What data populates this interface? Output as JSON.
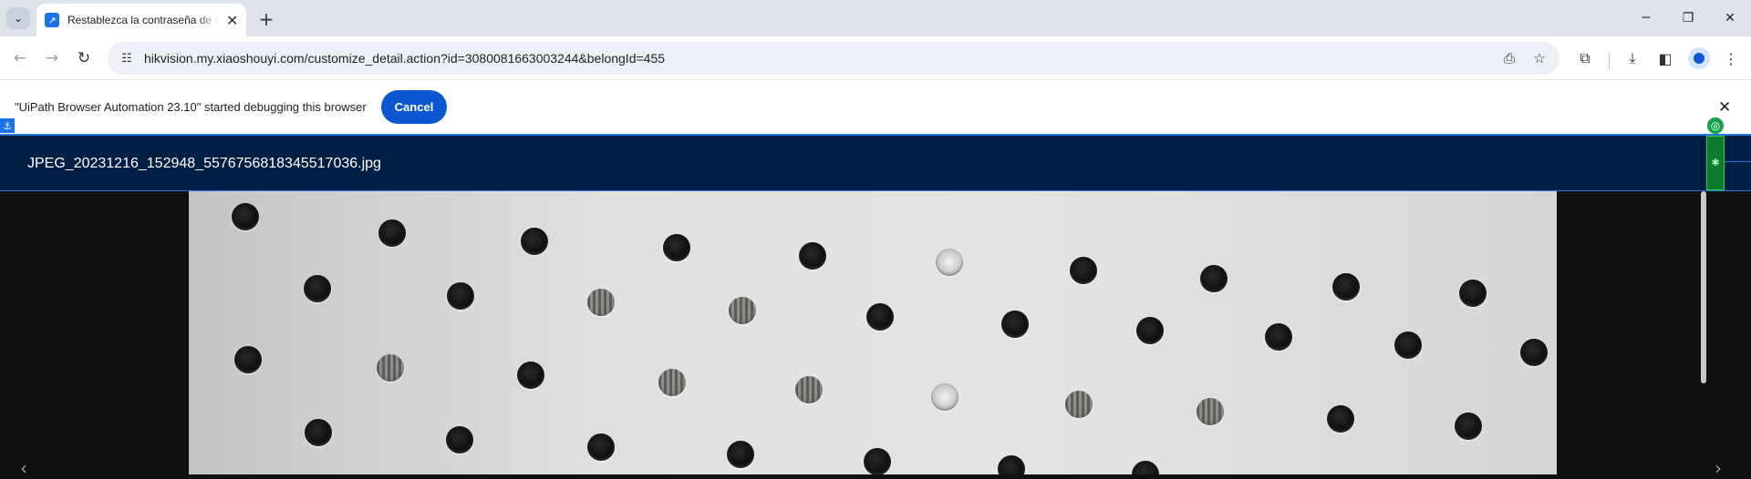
{
  "browser": {
    "tab": {
      "title": "Restablezca la contraseña de acceso",
      "favicon": "arrow-favicon"
    },
    "new_tab_symbol": "+",
    "url": "hikvision.my.xiaoshouyi.com/customize_detail.action?id=3080081663003244&belongId=455"
  },
  "infobar": {
    "message": "\"UiPath Browser Automation 23.10\" started debugging this browser",
    "cancel_label": "Cancel"
  },
  "viewer": {
    "file_name": "JPEG_20231216_152948_5576756818345517036.jpg"
  },
  "colors": {
    "tabstrip": "#dfe3eb",
    "header": "#001f45",
    "accent": "#0b57d0",
    "uipath_green": "#13a44a"
  }
}
